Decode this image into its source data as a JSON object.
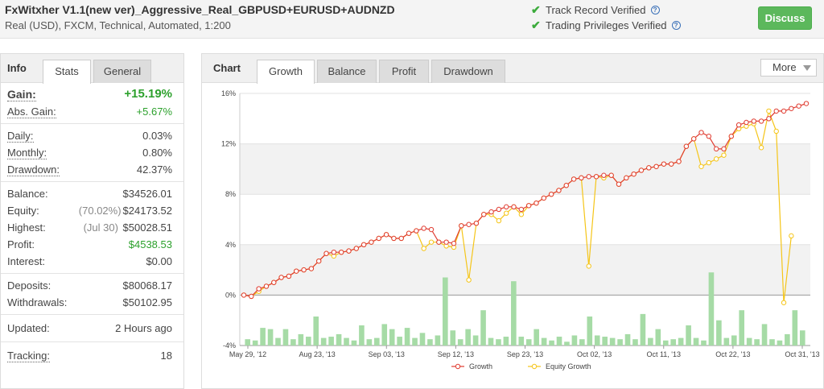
{
  "header": {
    "title": "FxWitxher V1.1(new ver)_Aggressive_Real_GBPUSD+EURUSD+AUDNZD",
    "subtitle": "Real (USD), FXCM, Technical, Automated, 1:200",
    "track_record": "Track Record Verified",
    "trading_privileges": "Trading Privileges Verified",
    "discuss_label": "Discuss",
    "help_glyph": "?"
  },
  "left_tabs": {
    "title": "Info",
    "stats": "Stats",
    "general": "General"
  },
  "stats": {
    "gain_label": "Gain:",
    "gain_value": "+15.19%",
    "abs_gain_label": "Abs. Gain:",
    "abs_gain_value": "+5.67%",
    "daily_label": "Daily:",
    "daily_value": "0.03%",
    "monthly_label": "Monthly:",
    "monthly_value": "0.80%",
    "drawdown_label": "Drawdown:",
    "drawdown_value": "42.37%",
    "balance_label": "Balance:",
    "balance_value": "$34526.01",
    "equity_label": "Equity:",
    "equity_pct": "(70.02%)",
    "equity_value": "$24173.52",
    "highest_label": "Highest:",
    "highest_date": "(Jul 30)",
    "highest_value": "$50028.51",
    "profit_label": "Profit:",
    "profit_value": "$4538.53",
    "interest_label": "Interest:",
    "interest_value": "$0.00",
    "deposits_label": "Deposits:",
    "deposits_value": "$80068.17",
    "withdrawals_label": "Withdrawals:",
    "withdrawals_value": "$50102.95",
    "updated_label": "Updated:",
    "updated_value": "2 Hours ago",
    "tracking_label": "Tracking:",
    "tracking_value": "18"
  },
  "chart_tabs": {
    "title": "Chart",
    "growth": "Growth",
    "balance": "Balance",
    "profit": "Profit",
    "drawdown": "Drawdown",
    "more": "More"
  },
  "colors": {
    "growth": "#e03c31",
    "equity": "#f5c518",
    "bars": "#a6dba6",
    "accent_green": "#2da12d"
  },
  "chart_data": {
    "type": "line",
    "y_ticks": [
      "16%",
      "12%",
      "8%",
      "4%",
      "0%",
      "-4%"
    ],
    "ylim": [
      -4,
      16
    ],
    "x_tick_labels": [
      "May 29, '12",
      "Aug 23, '13",
      "Sep 03, '13",
      "Sep 12, '13",
      "Sep 23, '13",
      "Oct 02, '13",
      "Oct 11, '13",
      "Oct 22, '13",
      "Oct 31, '13"
    ],
    "legend": [
      "Growth",
      "Equity Growth"
    ],
    "legend_position": "bottom",
    "series": [
      {
        "name": "Growth",
        "values": [
          0,
          -0.1,
          0.5,
          0.7,
          1.0,
          1.4,
          1.5,
          1.9,
          2.0,
          2.1,
          2.7,
          3.3,
          3.4,
          3.4,
          3.5,
          3.7,
          4.0,
          4.2,
          4.5,
          4.8,
          4.5,
          4.5,
          4.9,
          5.1,
          5.3,
          5.2,
          4.2,
          4.2,
          4.1,
          5.5,
          5.6,
          5.7,
          6.4,
          6.6,
          6.8,
          7.0,
          7.0,
          6.8,
          7.1,
          7.3,
          7.7,
          8.0,
          8.3,
          8.7,
          9.2,
          9.3,
          9.4,
          9.4,
          9.5,
          9.5,
          8.8,
          9.3,
          9.6,
          9.9,
          10.1,
          10.2,
          10.4,
          10.4,
          10.6,
          11.8,
          12.4,
          12.9,
          12.6,
          11.6,
          11.6,
          12.6,
          13.5,
          13.7,
          13.8,
          13.8,
          14.0,
          14.6,
          14.6,
          14.8,
          15.0,
          15.2
        ]
      },
      {
        "name": "Equity Growth",
        "values": [
          0,
          -0.1,
          0.3,
          0.7,
          1.0,
          1.4,
          1.5,
          1.9,
          2.0,
          2.1,
          2.7,
          3.3,
          3.1,
          3.4,
          3.5,
          3.7,
          4.0,
          4.2,
          4.5,
          4.8,
          4.5,
          4.5,
          4.9,
          5.1,
          3.7,
          4.2,
          4.2,
          3.9,
          3.8,
          5.5,
          1.2,
          5.7,
          6.4,
          6.4,
          5.9,
          6.5,
          7.0,
          6.4,
          7.1,
          7.3,
          7.7,
          8.0,
          8.3,
          8.7,
          9.2,
          9.3,
          2.3,
          9.4,
          9.3,
          9.5,
          8.8,
          9.3,
          9.6,
          9.9,
          10.1,
          10.2,
          10.4,
          10.4,
          10.6,
          11.8,
          12.4,
          10.2,
          10.5,
          10.8,
          11.1,
          12.6,
          13.2,
          13.4,
          13.6,
          11.7,
          14.6,
          13.0,
          -0.6,
          4.7
        ]
      },
      {
        "name": "Bars",
        "values": [
          0.5,
          0.4,
          1.4,
          1.3,
          0.6,
          1.3,
          0.5,
          0.9,
          0.7,
          2.3,
          0.6,
          0.7,
          0.9,
          0.6,
          0.4,
          1.6,
          0.5,
          0.6,
          1.7,
          1.3,
          0.7,
          1.4,
          0.6,
          1.0,
          0.5,
          0.8,
          5.4,
          1.2,
          0.5,
          1.3,
          0.8,
          2.8,
          0.6,
          0.5,
          0.7,
          5.1,
          0.7,
          0.5,
          1.3,
          0.6,
          0.4,
          0.7,
          0.3,
          0.8,
          0.5,
          2.3,
          0.8,
          0.7,
          0.6,
          0.5,
          0.9,
          0.5,
          2.5,
          0.6,
          1.3,
          0.4,
          0.5,
          0.6,
          1.6,
          0.6,
          0.4,
          5.8,
          2.0,
          0.6,
          0.8,
          2.8,
          0.6,
          0.5,
          1.7,
          0.5,
          0.4,
          0.9,
          2.8,
          1.2
        ]
      }
    ]
  }
}
